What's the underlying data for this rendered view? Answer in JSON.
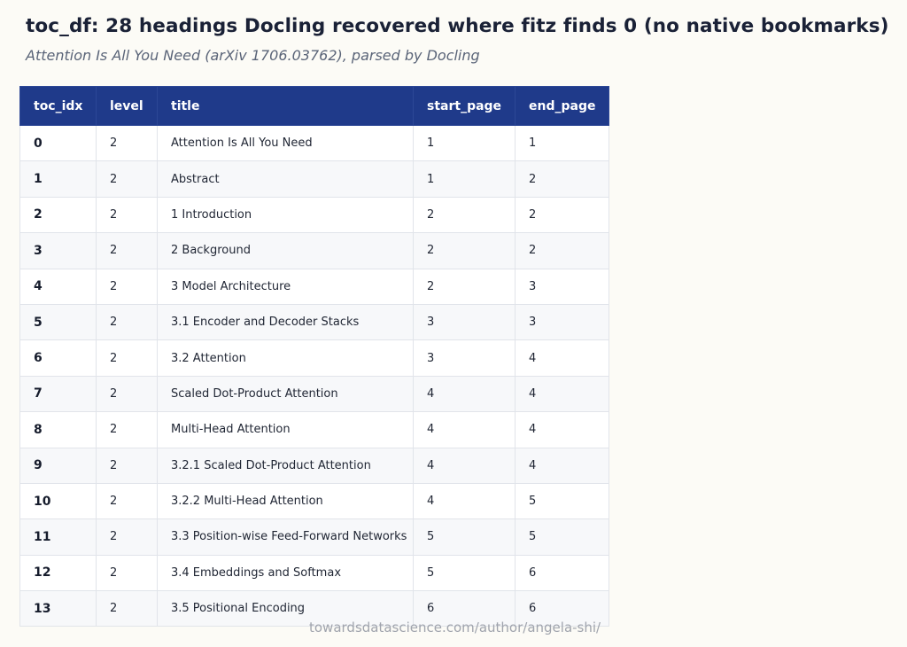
{
  "header": {
    "title": "toc_df: 28 headings Docling recovered where fitz finds 0 (no native bookmarks)",
    "subtitle": "Attention Is All You Need (arXiv 1706.03762), parsed by Docling"
  },
  "table": {
    "columns": [
      "toc_idx",
      "level",
      "title",
      "start_page",
      "end_page"
    ],
    "rows": [
      [
        "0",
        "2",
        "Attention Is All You Need",
        "1",
        "1"
      ],
      [
        "1",
        "2",
        "Abstract",
        "1",
        "2"
      ],
      [
        "2",
        "2",
        "1 Introduction",
        "2",
        "2"
      ],
      [
        "3",
        "2",
        "2 Background",
        "2",
        "2"
      ],
      [
        "4",
        "2",
        "3 Model Architecture",
        "2",
        "3"
      ],
      [
        "5",
        "2",
        "3.1 Encoder and Decoder Stacks",
        "3",
        "3"
      ],
      [
        "6",
        "2",
        "3.2 Attention",
        "3",
        "4"
      ],
      [
        "7",
        "2",
        "Scaled Dot-Product Attention",
        "4",
        "4"
      ],
      [
        "8",
        "2",
        "Multi-Head Attention",
        "4",
        "4"
      ],
      [
        "9",
        "2",
        "3.2.1 Scaled Dot-Product Attention",
        "4",
        "4"
      ],
      [
        "10",
        "2",
        "3.2.2 Multi-Head Attention",
        "4",
        "5"
      ],
      [
        "11",
        "2",
        "3.3 Position-wise Feed-Forward Networks",
        "5",
        "5"
      ],
      [
        "12",
        "2",
        "3.4 Embeddings and Softmax",
        "5",
        "6"
      ],
      [
        "13",
        "2",
        "3.5 Positional Encoding",
        "6",
        "6"
      ]
    ]
  },
  "watermark": "towardsdatascience.com/author/angela-shi/",
  "colors": {
    "header_bg": "#1f3a8a",
    "header_text": "#ffffff",
    "page_bg": "#fcfbf6",
    "row_alt_bg": "#f7f8fa",
    "title_text": "#1a2136",
    "subtitle_text": "#5a6478"
  }
}
